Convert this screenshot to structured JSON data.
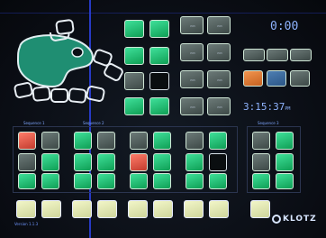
{
  "time_display": "0:00",
  "clock_display": "3:15:37",
  "clock_suffix": "PM",
  "brand_logo": "KLOTZ",
  "version_label": "Version 1.1.3",
  "section_labels": [
    "Sequence 1",
    "Sequence 2",
    "Sequence 3"
  ],
  "colors": {
    "green": "#2ec27e",
    "red": "#e2574c",
    "blue": "#3a6ea5",
    "orange": "#e07b39",
    "background": "#0b0f16"
  },
  "icons": [
    "palette-icon",
    "color-ring-icon",
    "klotz-logo-icon"
  ]
}
